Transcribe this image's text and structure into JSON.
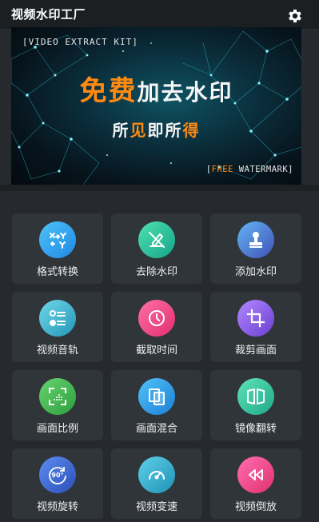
{
  "app": {
    "title": "视频水印工厂"
  },
  "banner": {
    "top_text": "[VIDEO EXTRACT KIT]",
    "headline_highlight": "免费",
    "headline_rest": "加去水印",
    "sub_part1": "所",
    "sub_highlight1": "见",
    "sub_part2": "即所",
    "sub_highlight2": "得",
    "bottom_bracket_open": "[",
    "bottom_accent": "FREE",
    "bottom_rest": " WATERMARK]"
  },
  "tools": [
    {
      "label": "格式转换",
      "icon": "format-convert-icon",
      "color_a": "#4fc3f7",
      "color_b": "#1e88e5"
    },
    {
      "label": "去除水印",
      "icon": "remove-watermark-icon",
      "color_a": "#4ee0b0",
      "color_b": "#17a589"
    },
    {
      "label": "添加水印",
      "icon": "add-watermark-icon",
      "color_a": "#64b5f6",
      "color_b": "#3f51b5"
    },
    {
      "label": "视频音轨",
      "icon": "audio-track-icon",
      "color_a": "#6fd8e8",
      "color_b": "#2596b8"
    },
    {
      "label": "截取时间",
      "icon": "clock-icon",
      "color_a": "#ff6fa8",
      "color_b": "#e0306e"
    },
    {
      "label": "裁剪画面",
      "icon": "crop-icon",
      "color_a": "#b388ff",
      "color_b": "#6a3fd0"
    },
    {
      "label": "画面比例",
      "icon": "aspect-ratio-icon",
      "color_a": "#66d36e",
      "color_b": "#2e9e3e"
    },
    {
      "label": "画面混合",
      "icon": "blend-icon",
      "color_a": "#4fc3f7",
      "color_b": "#1e7fd6"
    },
    {
      "label": "镜像翻转",
      "icon": "mirror-flip-icon",
      "color_a": "#5ee3b8",
      "color_b": "#1fa98a"
    },
    {
      "label": "视频旋转",
      "icon": "rotate-90-icon",
      "color_a": "#5c8df0",
      "color_b": "#2c4fb8"
    },
    {
      "label": "视频变速",
      "icon": "speedometer-icon",
      "color_a": "#5fd0e8",
      "color_b": "#1f93b8"
    },
    {
      "label": "视频倒放",
      "icon": "rewind-icon",
      "color_a": "#ff6fb0",
      "color_b": "#e03070"
    }
  ]
}
